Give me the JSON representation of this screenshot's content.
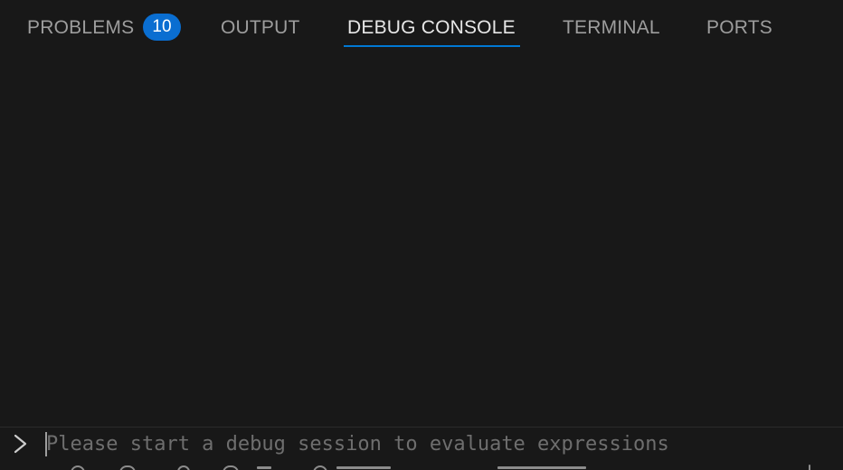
{
  "panel": {
    "tabs": [
      {
        "label": "PROBLEMS",
        "badge": "10",
        "active": false
      },
      {
        "label": "OUTPUT",
        "active": false
      },
      {
        "label": "DEBUG CONSOLE",
        "active": true
      },
      {
        "label": "TERMINAL",
        "active": false
      },
      {
        "label": "PORTS",
        "active": false
      }
    ]
  },
  "console": {
    "prompt_icon": "chevron-right-icon",
    "input_value": "",
    "input_placeholder": "Please start a debug session to evaluate expressions"
  },
  "colors": {
    "background": "#181818",
    "active_tab_text": "#e7e7e7",
    "inactive_tab_text": "#9d9d9d",
    "active_tab_underline": "#0078d4",
    "badge_background": "#0a6ed1",
    "placeholder_text": "#6e6e6e"
  }
}
